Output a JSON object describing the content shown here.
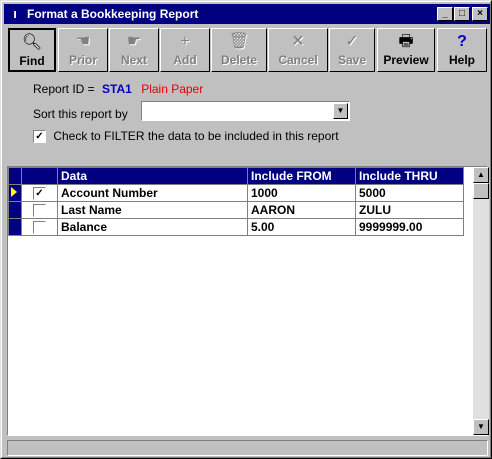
{
  "window": {
    "title": "Format a Bookkeeping Report",
    "icon": "app-icon"
  },
  "window_buttons": {
    "minimize": "_",
    "maximize": "□",
    "close": "×"
  },
  "toolbar": {
    "find": "Find",
    "prior": "Prior",
    "next": "Next",
    "add": "Add",
    "delete": "Delete",
    "cancel": "Cancel",
    "save": "Save",
    "preview": "Preview",
    "help": "Help"
  },
  "report": {
    "id_label": "Report ID =",
    "id_value": "STA1",
    "paper": "Plain Paper",
    "colors": {
      "id": "#0000c0",
      "paper": "#e00000"
    }
  },
  "sort": {
    "label": "Sort this report by",
    "value": ""
  },
  "filter": {
    "label": "Check to FILTER the data to be included in this report",
    "checked": true
  },
  "grid": {
    "headers": {
      "data": "Data",
      "from": "Include FROM",
      "thru": "Include THRU"
    },
    "rows": [
      {
        "checked": true,
        "data": "Account Number",
        "from": "1000",
        "thru": "5000",
        "current": true
      },
      {
        "checked": false,
        "data": "Last Name",
        "from": "AARON",
        "thru": "ZULU",
        "current": false
      },
      {
        "checked": false,
        "data": "Balance",
        "from": "5.00",
        "thru": "9999999.00",
        "current": false
      }
    ]
  }
}
